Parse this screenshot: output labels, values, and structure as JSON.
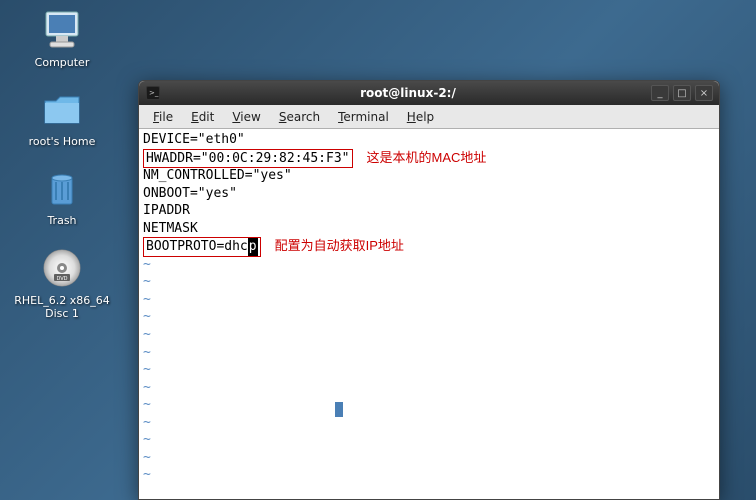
{
  "desktop": {
    "icons": [
      {
        "label": "Computer",
        "name": "computer-icon"
      },
      {
        "label": "root's Home",
        "name": "home-icon"
      },
      {
        "label": "Trash",
        "name": "trash-icon"
      },
      {
        "label": "RHEL_6.2 x86_64\nDisc 1",
        "name": "dvd-icon"
      }
    ]
  },
  "window": {
    "title": "root@linux-2:/",
    "controls": {
      "min": "_",
      "max": "□",
      "close": "×"
    },
    "menus": [
      "File",
      "Edit",
      "View",
      "Search",
      "Terminal",
      "Help"
    ]
  },
  "terminal": {
    "lines": [
      {
        "text": "DEVICE=\"eth0\""
      },
      {
        "text": "HWADDR=\"00:0C:29:82:45:F3\"",
        "boxed": true,
        "note": "这是本机的MAC地址"
      },
      {
        "text": "NM_CONTROLLED=\"yes\""
      },
      {
        "text": "ONBOOT=\"yes\""
      },
      {
        "text": "IPADDR"
      },
      {
        "text": "NETMASK"
      },
      {
        "text": "BOOTPROTO=dhcp",
        "boxed": true,
        "note": "配置为自动获取IP地址",
        "cursor_at": "p"
      }
    ],
    "tilde": "~"
  }
}
